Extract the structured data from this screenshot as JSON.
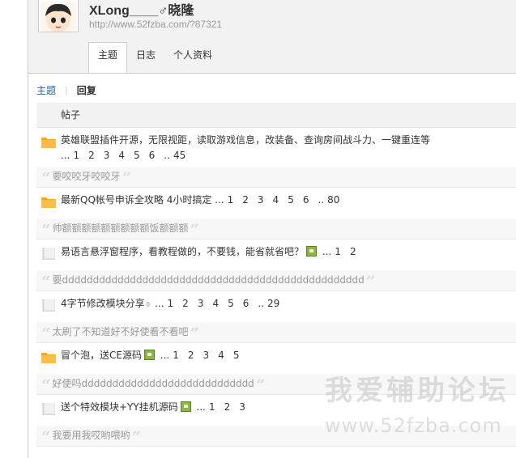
{
  "profile": {
    "username": "XLong____♂晓隆",
    "url": "http://www.52fzba.com/?87321"
  },
  "tabs": [
    {
      "label": "主题",
      "active": true
    },
    {
      "label": "日志",
      "active": false
    },
    {
      "label": "个人资料",
      "active": false
    }
  ],
  "subnav": {
    "topic": "主题",
    "separator": "|",
    "reply": "回复"
  },
  "list": {
    "header": "帖子",
    "rows": [
      {
        "icon": "folder-icon",
        "title": "英雄联盟插件开源，无限视距，读取游戏信息，改装备、查询房间战斗力、一键重连等",
        "pages_prefix": "...",
        "pages": [
          "1",
          "2",
          "3",
          "4",
          "5",
          "6",
          "..",
          "45"
        ],
        "reply": "要咬咬牙咬咬牙"
      },
      {
        "icon": "folder-icon",
        "title": "最新QQ帐号申诉全攻略 4小时搞定",
        "pages_prefix": "...",
        "pages": [
          "1",
          "2",
          "3",
          "4",
          "5",
          "6",
          "..",
          "80"
        ],
        "reply": "帅额额额额额额额额额饭额额额"
      },
      {
        "icon": "doc-icon",
        "title": "易语言悬浮窗程序，看教程做的，不要钱，能省就省吧？",
        "has_image": true,
        "pages_prefix": "...",
        "pages": [
          "1",
          "2"
        ],
        "reply": "要ddddddddddddddddddddddddddddddddddddddddddddddddd"
      },
      {
        "icon": "doc-icon",
        "title": "4字节修改模块分享",
        "has_attachment": true,
        "pages_prefix": "...",
        "pages": [
          "1",
          "2",
          "3",
          "4",
          "5",
          "6",
          "..",
          "29"
        ],
        "reply": "太刷了不知道好不好使看不看吧"
      },
      {
        "icon": "folder-icon",
        "title": "冒个泡，送CE源码",
        "has_image": true,
        "pages_prefix": "...",
        "pages": [
          "1",
          "2",
          "3",
          "4",
          "5"
        ],
        "reply": "好使吗dddddddddddddddddddddddddddd"
      },
      {
        "icon": "doc-icon",
        "title": "送个特效模块+YY挂机源码",
        "has_image": true,
        "pages_prefix": "...",
        "pages": [
          "1",
          "2",
          "3"
        ],
        "reply": "我要用我哎哟喂哟"
      }
    ]
  },
  "watermark": {
    "line1": "我爱辅助论坛",
    "line2": "www.52fzba.com"
  },
  "colors": {
    "link": "#336699",
    "header_bg": "#f2f2f2",
    "folder": "#f6a623",
    "reply_bg": "#f7f7f7"
  }
}
